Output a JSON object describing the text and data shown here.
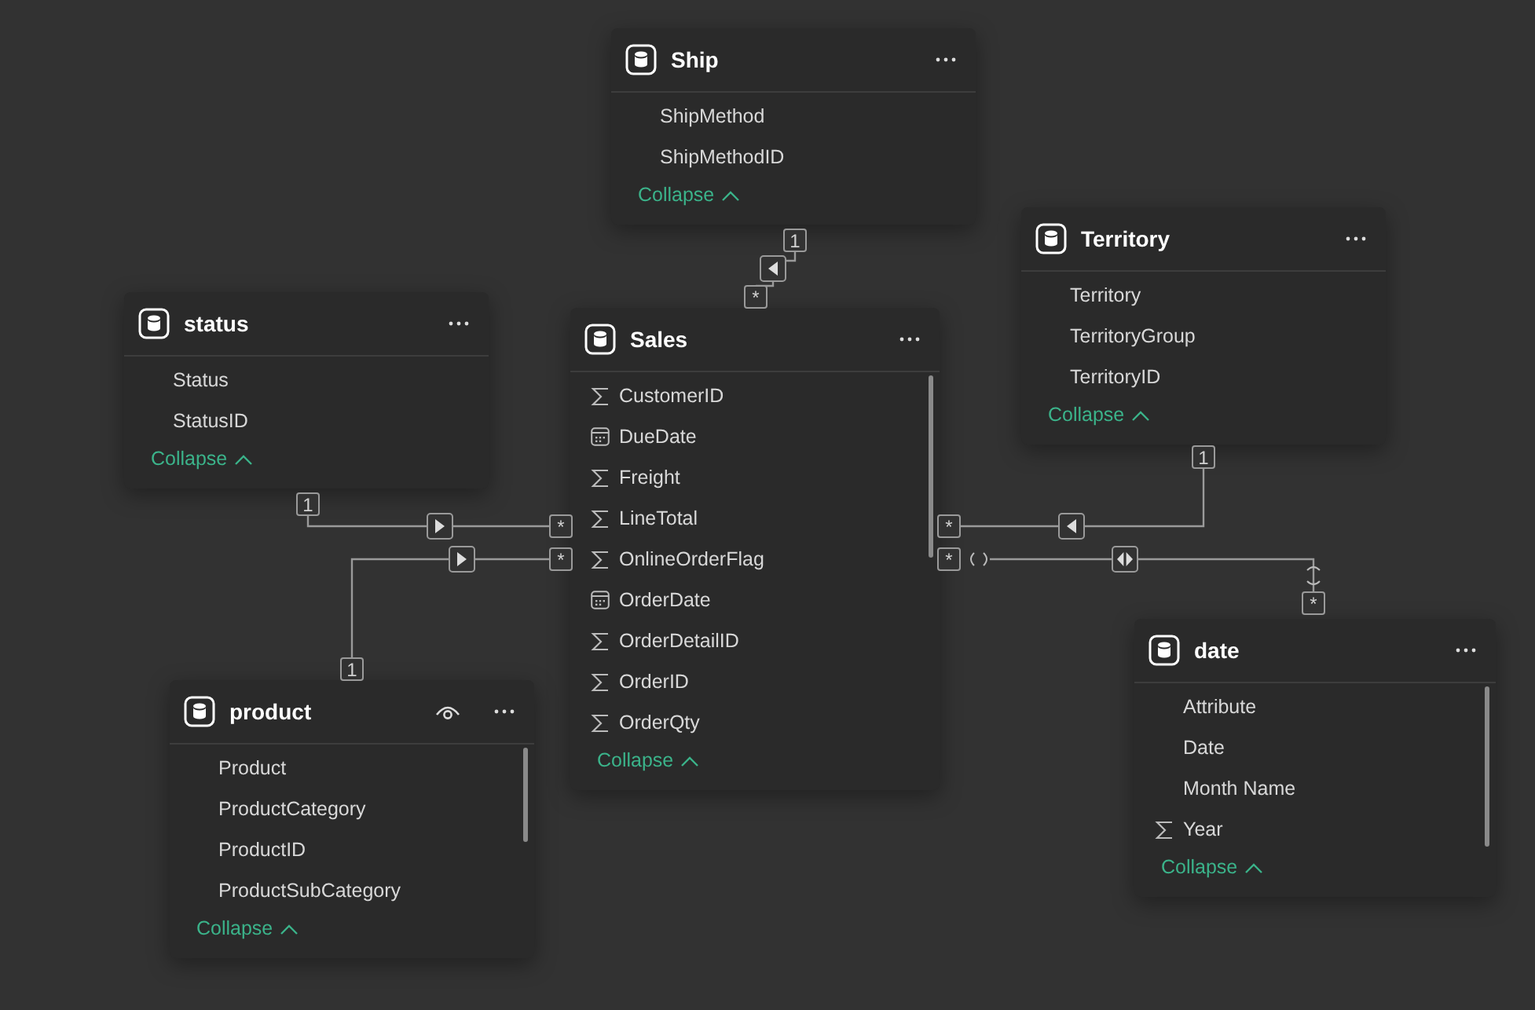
{
  "tables": [
    {
      "name": "Ship",
      "eye": false,
      "scrollbar": false,
      "fields": [
        {
          "name": "ShipMethod",
          "kind": "text"
        },
        {
          "name": "ShipMethodID",
          "kind": "text"
        }
      ],
      "collapse": "Collapse"
    },
    {
      "name": "Territory",
      "eye": false,
      "scrollbar": false,
      "fields": [
        {
          "name": "Territory",
          "kind": "text"
        },
        {
          "name": "TerritoryGroup",
          "kind": "text"
        },
        {
          "name": "TerritoryID",
          "kind": "text"
        }
      ],
      "collapse": "Collapse"
    },
    {
      "name": "status",
      "eye": false,
      "scrollbar": false,
      "fields": [
        {
          "name": "Status",
          "kind": "text"
        },
        {
          "name": "StatusID",
          "kind": "text"
        }
      ],
      "collapse": "Collapse"
    },
    {
      "name": "Sales",
      "eye": false,
      "scrollbar": true,
      "fields": [
        {
          "name": "CustomerID",
          "kind": "sum"
        },
        {
          "name": "DueDate",
          "kind": "date"
        },
        {
          "name": "Freight",
          "kind": "sum"
        },
        {
          "name": "LineTotal",
          "kind": "sum"
        },
        {
          "name": "OnlineOrderFlag",
          "kind": "sum"
        },
        {
          "name": "OrderDate",
          "kind": "date"
        },
        {
          "name": "OrderDetailID",
          "kind": "sum"
        },
        {
          "name": "OrderID",
          "kind": "sum"
        },
        {
          "name": "OrderQty",
          "kind": "sum"
        }
      ],
      "collapse": "Collapse"
    },
    {
      "name": "product",
      "eye": true,
      "scrollbar": true,
      "fields": [
        {
          "name": "Product",
          "kind": "text"
        },
        {
          "name": "ProductCategory",
          "kind": "text"
        },
        {
          "name": "ProductID",
          "kind": "text"
        },
        {
          "name": "ProductSubCategory",
          "kind": "text"
        }
      ],
      "collapse": "Collapse"
    },
    {
      "name": "date",
      "eye": false,
      "scrollbar": true,
      "fields": [
        {
          "name": "Attribute",
          "kind": "text"
        },
        {
          "name": "Date",
          "kind": "text"
        },
        {
          "name": "Month Name",
          "kind": "text"
        },
        {
          "name": "Year",
          "kind": "sum"
        }
      ],
      "collapse": "Collapse"
    }
  ],
  "relationships": [
    {
      "one_end": "1",
      "many_end": "*",
      "kind": "left"
    },
    {
      "one_end": "1",
      "many_end": "*",
      "kind": "right"
    },
    {
      "one_end": "1",
      "many_end": "*",
      "kind": "right"
    },
    {
      "one_end": "1",
      "many_end": "*",
      "kind": "left"
    },
    {
      "one_end": "*",
      "many_end": "*",
      "kind": "both"
    }
  ]
}
